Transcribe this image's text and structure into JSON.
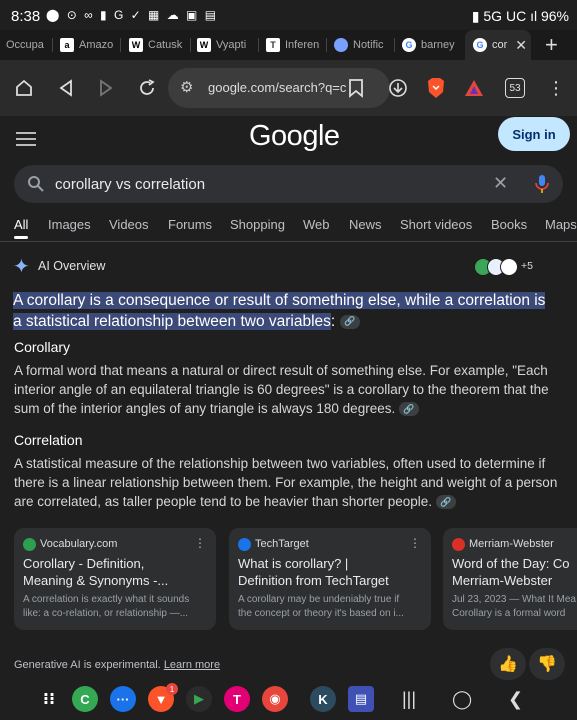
{
  "status": {
    "time": "8:38",
    "left_icons": "⬤ ⊙ ∞ ▮ G ✓ ▦ ☁ ▣ ▤",
    "network": "5G UC",
    "battery": "96%"
  },
  "tabs": [
    {
      "label": "Occupa",
      "icon": "blank",
      "color": "#444"
    },
    {
      "label": "Amazo",
      "icon": "a",
      "color": "#fff"
    },
    {
      "label": "Catusk",
      "icon": "W",
      "color": "#fff"
    },
    {
      "label": "Vyapti",
      "icon": "W",
      "color": "#fff"
    },
    {
      "label": "Inferen",
      "icon": "T",
      "color": "#fff"
    },
    {
      "label": "Notific",
      "icon": "circle",
      "color": "#7aa0ff"
    },
    {
      "label": "barney",
      "icon": "G",
      "color": "#fff"
    },
    {
      "label": "cor",
      "icon": "G",
      "color": "#fff"
    }
  ],
  "toolbar": {
    "url": "google.com/search?q=c",
    "tab_count": "53"
  },
  "google": {
    "logo": "Google",
    "sign_in": "Sign in",
    "query": "corollary vs correlation"
  },
  "search_tabs": [
    "All",
    "Images",
    "Videos",
    "Forums",
    "Shopping",
    "Web",
    "News",
    "Short videos",
    "Books",
    "Maps"
  ],
  "ai": {
    "title": "AI Overview",
    "more_sources": "+5",
    "summary": "A corollary is a consequence or result of something else, while a correlation is a statistical relationship between two variables",
    "summary_end": ":",
    "corollary_heading": "Corollary",
    "corollary_text": "A formal word that means a natural or direct result of something else. For example, \"Each interior angle of an equilateral triangle is 60 degrees\" is a corollary to the theorem that the sum of the interior angles of any triangle is always 180 degrees.",
    "correlation_heading": "Correlation",
    "correlation_text": "A statistical measure of the relationship between two variables, often used to determine if there is a linear relationship between them. For example, the height and weight of a person are correlated, as taller people tend to be heavier than shorter people.",
    "footer_text": "Generative AI is experimental.",
    "learn_more": "Learn more"
  },
  "cards": [
    {
      "site": "Vocabulary.com",
      "title1": "Corollary - Definition,",
      "title2": "Meaning & Synonyms -...",
      "desc1": "A correlation is exactly what it sounds",
      "desc2": "like: a co-relation, or relationship —...",
      "fav_color": "#2e9e4f"
    },
    {
      "site": "TechTarget",
      "title1": "What is corollary? |",
      "title2": "Definition from TechTarget",
      "desc1": "A corollary may be undeniably true if",
      "desc2": "the concept or theory it's based on i...",
      "fav_color": "#1a73e8"
    },
    {
      "site": "Merriam-Webster",
      "title1": "Word of the Day: Co",
      "title2": "Merriam-Webster",
      "desc1": "Jul 23, 2023 — What It Mea",
      "desc2": "Corollary is a formal word",
      "fav_color": "#d93025"
    }
  ],
  "dock_badge": "1"
}
